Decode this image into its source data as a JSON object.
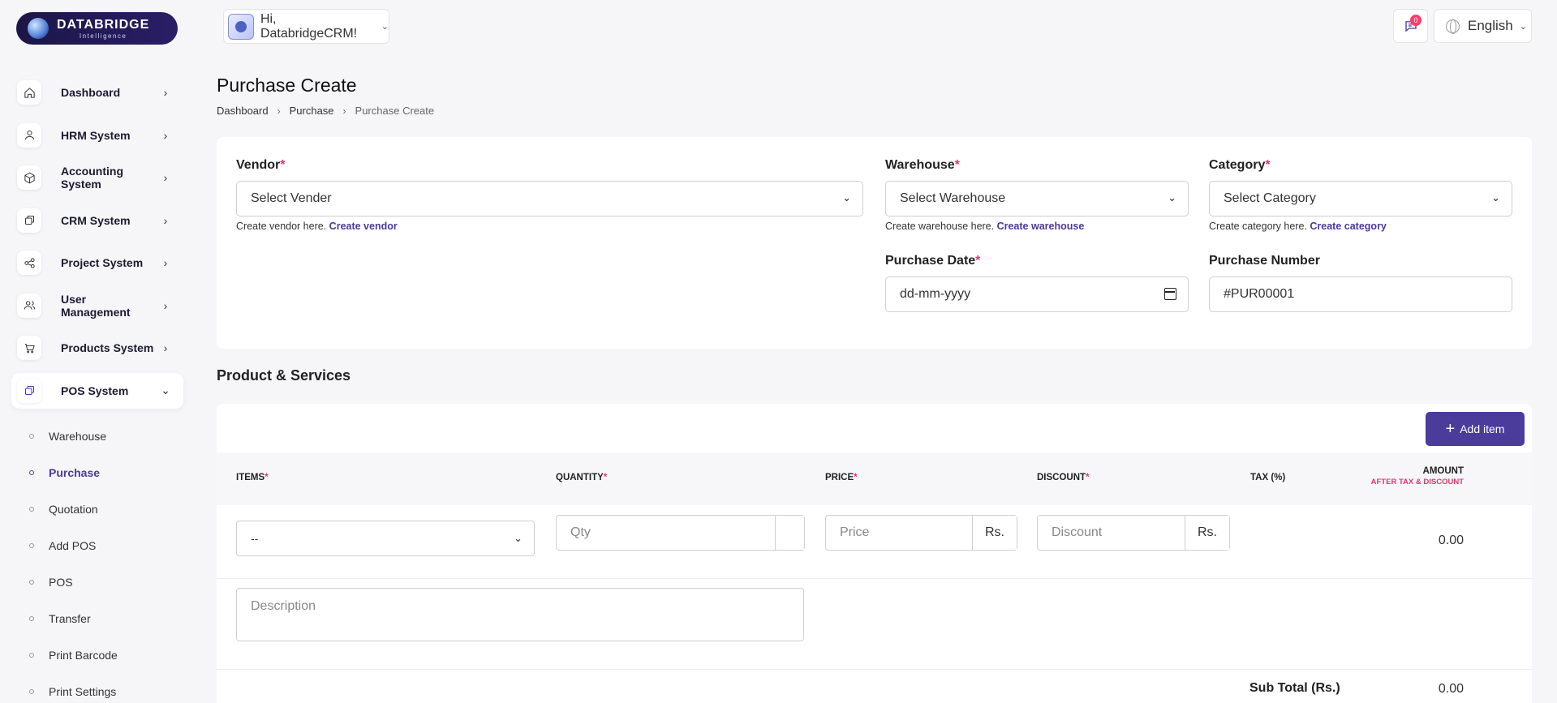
{
  "brand": {
    "name": "DATABRIDGE",
    "tagline": "Intelligence"
  },
  "topbar": {
    "greeting": "Hi, DatabridgeCRM!",
    "notification_count": "0",
    "language": "English"
  },
  "sidebar": {
    "items": [
      {
        "label": "Dashboard",
        "icon": "home-icon"
      },
      {
        "label": "HRM System",
        "icon": "user-icon"
      },
      {
        "label": "Accounting System",
        "icon": "box-icon"
      },
      {
        "label": "CRM System",
        "icon": "layers-icon"
      },
      {
        "label": "Project System",
        "icon": "share-icon"
      },
      {
        "label": "User Management",
        "icon": "users-icon"
      },
      {
        "label": "Products System",
        "icon": "cart-icon"
      },
      {
        "label": "POS System",
        "icon": "layers-icon"
      }
    ],
    "pos_subitems": [
      "Warehouse",
      "Purchase",
      "Quotation",
      "Add POS",
      "POS",
      "Transfer",
      "Print Barcode",
      "Print Settings"
    ],
    "active_subitem": "Purchase"
  },
  "page": {
    "title": "Purchase Create",
    "breadcrumb": [
      "Dashboard",
      "Purchase",
      "Purchase Create"
    ]
  },
  "form": {
    "vendor": {
      "label": "Vendor",
      "placeholder": "Select Vender",
      "help": "Create vendor here.",
      "link": "Create vendor"
    },
    "warehouse": {
      "label": "Warehouse",
      "placeholder": "Select Warehouse",
      "help": "Create warehouse here.",
      "link": "Create warehouse"
    },
    "category": {
      "label": "Category",
      "placeholder": "Select Category",
      "help": "Create category here.",
      "link": "Create category"
    },
    "purchase_date": {
      "label": "Purchase Date",
      "placeholder": "dd-mm-yyyy"
    },
    "purchase_number": {
      "label": "Purchase Number",
      "value": "#PUR00001"
    }
  },
  "products": {
    "title": "Product & Services",
    "add_button": "Add item",
    "columns": {
      "items": "ITEMS",
      "quantity": "QUANTITY",
      "price": "PRICE",
      "discount": "DISCOUNT",
      "tax": "TAX (%)",
      "amount": "AMOUNT",
      "amount_sub": "AFTER TAX & DISCOUNT"
    },
    "row": {
      "item_select": "--",
      "qty_placeholder": "Qty",
      "price_placeholder": "Price",
      "price_currency": "Rs.",
      "discount_placeholder": "Discount",
      "discount_currency": "Rs.",
      "amount": "0.00",
      "description_placeholder": "Description"
    },
    "subtotal_label": "Sub Total (Rs.)",
    "subtotal_value": "0.00"
  },
  "colors": {
    "accent": "#4b3b9a",
    "required": "#e8336b",
    "background": "#f6f6f9"
  }
}
